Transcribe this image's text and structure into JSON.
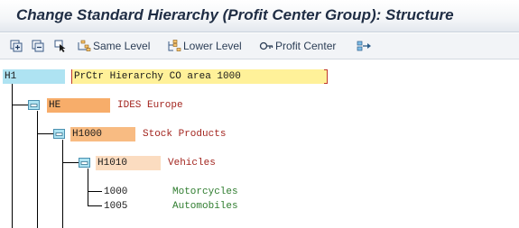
{
  "window": {
    "title": "Change Standard Hierarchy (Profit Center Group): Structure"
  },
  "toolbar": {
    "items": [
      {
        "icon": "expand-subtree-icon",
        "label": ""
      },
      {
        "icon": "collapse-subtree-icon",
        "label": ""
      },
      {
        "icon": "select-cursor-icon",
        "label": ""
      },
      {
        "icon": "same-level-icon",
        "label": "Same Level"
      },
      {
        "icon": "lower-level-icon",
        "label": "Lower Level"
      },
      {
        "icon": "profit-center-icon",
        "label": "Profit Center"
      },
      {
        "icon": "move-node-icon",
        "label": ""
      }
    ]
  },
  "tree": {
    "root": {
      "key": "H1",
      "desc": "PrCtr Hierarchy CO area 1000"
    },
    "node_he": {
      "key": "HE",
      "desc": "IDES Europe"
    },
    "node_h1000": {
      "key": "H1000",
      "desc": "Stock Products"
    },
    "node_h1010": {
      "key": "H1010",
      "desc": "Vehicles"
    },
    "leaves": [
      {
        "key": "1000",
        "desc": "Motorcycles"
      },
      {
        "key": "1005",
        "desc": "Automobiles"
      }
    ]
  },
  "colors": {
    "title_text": "#1f2d44",
    "root_key_bg": "#aee3f2",
    "root_desc_bg": "#fff199",
    "he_key_bg": "#f7ad6a",
    "h1000_key_bg": "#f8bb82",
    "h1010_key_bg": "#fbdcc0",
    "folder_fill": "#aee3f2",
    "group_desc_text": "#a3251f",
    "leaf_desc_text": "#2f7d2f",
    "selection_bracket": "#c0392b"
  }
}
